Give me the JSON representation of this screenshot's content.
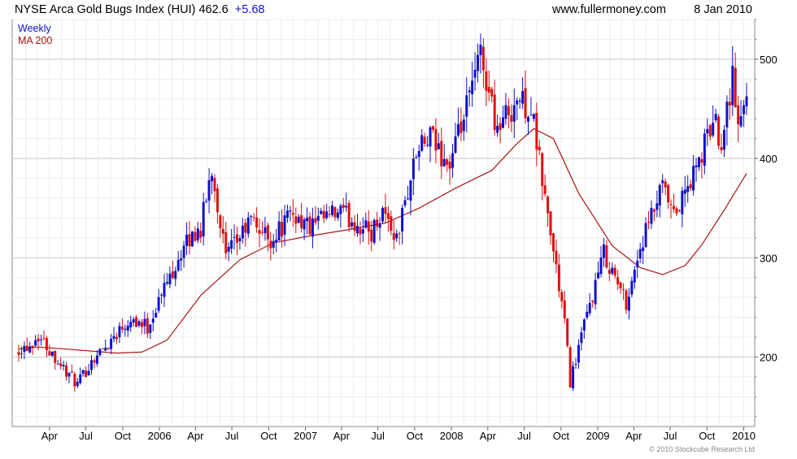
{
  "header": {
    "title_prefix": "NYSE Arca Gold Bugs Index (HUI) 462.6",
    "change": "+5.68",
    "source": "www.fullermoney.com",
    "date": "8 Jan 2010"
  },
  "legend": {
    "weekly": "Weekly",
    "ma": "MA 200"
  },
  "footer": {
    "copyright": "© 2010 Stockcube Research Ltd"
  },
  "colors": {
    "up": "#1010cc",
    "down": "#dd1010",
    "ma": "#aa1414",
    "grid": "#c8c8c8",
    "change_text": "#1010cc",
    "legend_weekly": "#1010cc",
    "legend_ma": "#aa1414"
  },
  "chart_data": {
    "type": "candlestick",
    "title": "NYSE Arca Gold Bugs Index (HUI)",
    "y_axis_side": "right",
    "ylim": [
      130,
      540
    ],
    "ytick_labels": [
      "200",
      "300",
      "400",
      "500"
    ],
    "ytick_values": [
      200,
      300,
      400,
      500
    ],
    "xtick_labels": [
      "Apr",
      "Jul",
      "Oct",
      "2006",
      "Apr",
      "Jul",
      "Oct",
      "2007",
      "Apr",
      "Jul",
      "Oct",
      "2008",
      "Apr",
      "Jul",
      "Oct",
      "2009",
      "Apr",
      "Jul",
      "Oct",
      "2010"
    ],
    "xtick_dates": [
      "2005-04-01",
      "2005-07-01",
      "2005-10-01",
      "2006-01-01",
      "2006-04-01",
      "2006-07-01",
      "2006-10-01",
      "2007-01-01",
      "2007-04-01",
      "2007-07-01",
      "2007-10-01",
      "2008-01-01",
      "2008-04-01",
      "2008-07-01",
      "2008-10-01",
      "2009-01-01",
      "2009-04-01",
      "2009-07-01",
      "2009-10-01",
      "2010-01-01"
    ],
    "x_range": [
      "2005-01-14",
      "2010-01-08"
    ],
    "grid": true,
    "legend_position": "top-left",
    "series": [
      {
        "name": "Weekly",
        "anchor_dates": [
          "2005-01-14",
          "2005-02-11",
          "2005-03-04",
          "2005-04-15",
          "2005-05-13",
          "2005-06-10",
          "2005-07-22",
          "2005-08-19",
          "2005-09-16",
          "2005-10-21",
          "2005-12-02",
          "2006-01-13",
          "2006-02-17",
          "2006-03-24",
          "2006-04-14",
          "2006-05-12",
          "2006-06-16",
          "2006-08-18",
          "2006-10-06",
          "2006-12-01",
          "2007-01-12",
          "2007-02-23",
          "2007-03-30",
          "2007-06-15",
          "2007-07-13",
          "2007-08-17",
          "2007-10-05",
          "2007-11-09",
          "2007-12-28",
          "2008-02-08",
          "2008-03-14",
          "2008-04-25",
          "2008-06-13",
          "2008-07-18",
          "2008-08-22",
          "2008-10-10",
          "2008-10-24",
          "2008-11-14",
          "2009-01-16",
          "2009-03-13",
          "2009-04-17",
          "2009-06-12",
          "2009-07-10",
          "2009-09-11",
          "2009-10-16",
          "2009-11-06",
          "2009-12-04",
          "2009-12-18",
          "2010-01-08"
        ],
        "anchor_closes": [
          209,
          212,
          222,
          200,
          185,
          172,
          200,
          210,
          225,
          240,
          230,
          270,
          300,
          322,
          330,
          390,
          300,
          338,
          318,
          345,
          330,
          340,
          345,
          325,
          350,
          318,
          405,
          420,
          392,
          450,
          505,
          430,
          460,
          450,
          360,
          235,
          175,
          210,
          305,
          255,
          310,
          370,
          340,
          395,
          440,
          420,
          485,
          430,
          462.6
        ],
        "volatility": 9,
        "seed": 17
      },
      {
        "name": "MA 200",
        "dates": [
          "2005-01-14",
          "2005-03-04",
          "2005-05-13",
          "2005-09-16",
          "2005-11-18",
          "2006-01-20",
          "2006-04-14",
          "2006-07-21",
          "2006-10-13",
          "2007-01-12",
          "2007-04-13",
          "2007-07-20",
          "2007-10-12",
          "2008-01-11",
          "2008-04-11",
          "2008-06-13",
          "2008-07-25",
          "2008-09-12",
          "2008-11-14",
          "2009-02-06",
          "2009-04-17",
          "2009-06-12",
          "2009-08-07",
          "2009-09-18",
          "2009-11-13",
          "2010-01-08"
        ],
        "values": [
          208,
          210,
          208,
          204,
          205,
          217,
          262,
          298,
          315,
          322,
          328,
          335,
          350,
          370,
          388,
          415,
          430,
          420,
          365,
          312,
          290,
          283,
          292,
          313,
          348,
          385
        ]
      }
    ]
  }
}
